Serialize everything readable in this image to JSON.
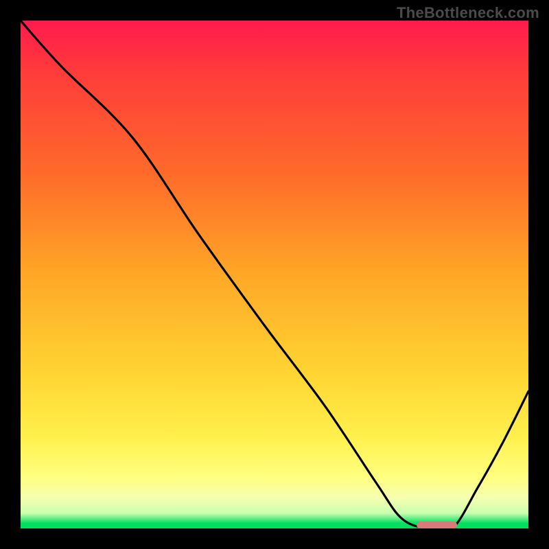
{
  "watermark": "TheBottleneck.com",
  "colors": {
    "background": "#000000",
    "gradient_top": "#ff1a4d",
    "gradient_bottom": "#00e060",
    "curve": "#000000",
    "valley_marker": "#d97a7a",
    "watermark_text": "#4b4b4b"
  },
  "chart_data": {
    "type": "line",
    "title": "",
    "xlabel": "",
    "ylabel": "",
    "xlim": [
      0,
      100
    ],
    "ylim": [
      0,
      100
    ],
    "grid": false,
    "legend": false,
    "series": [
      {
        "name": "bottleneck-curve",
        "x": [
          0,
          8,
          22,
          35,
          48,
          60,
          70,
          75,
          80,
          85,
          90,
          95,
          100
        ],
        "values": [
          100,
          91,
          77,
          58,
          40,
          24,
          9,
          2,
          0,
          0,
          8,
          17,
          27
        ]
      }
    ],
    "annotations": [
      {
        "name": "valley-marker",
        "x_start": 78,
        "x_end": 86,
        "y": 0.7
      }
    ]
  }
}
